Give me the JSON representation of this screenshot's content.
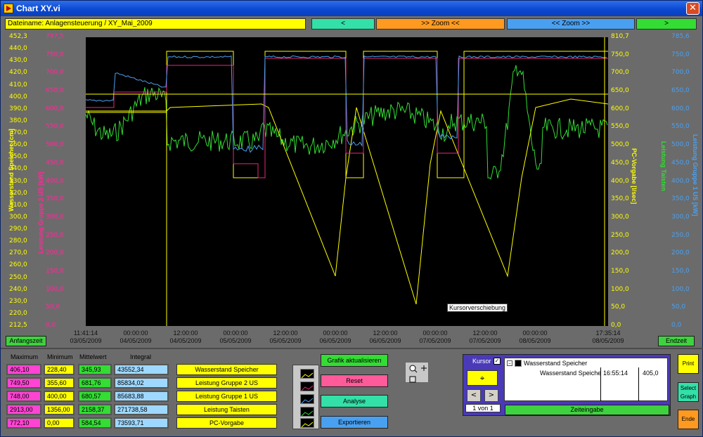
{
  "window": {
    "title": "Chart XY.vi",
    "close_glyph": "✕"
  },
  "header": {
    "filename": "Dateiname: Anlagensteuerung / XY_Mai_2009",
    "prev_label": "<",
    "zoom_in_label": ">> Zoom <<",
    "zoom_out_label": "<< Zoom >>",
    "next_label": ">"
  },
  "axes": {
    "ax1_ticks": [
      "452,3",
      "440,0",
      "430,0",
      "420,0",
      "410,0",
      "400,0",
      "390,0",
      "380,0",
      "370,0",
      "360,0",
      "350,0",
      "340,0",
      "330,0",
      "320,0",
      "310,0",
      "300,0",
      "290,0",
      "280,0",
      "270,0",
      "260,0",
      "250,0",
      "240,0",
      "230,0",
      "220,0",
      "212,5"
    ],
    "ax1_title": "Wasserstand Speicher [cm]",
    "ax2_ticks": [
      "797,5",
      "750,0",
      "700,0",
      "650,0",
      "600,0",
      "550,0",
      "500,0",
      "450,0",
      "400,0",
      "350,0",
      "300,0",
      "250,0",
      "200,0",
      "150,0",
      "100,0",
      "50,0",
      "0,0"
    ],
    "ax2_title": "Leistung Gruppe 2 US [kW]",
    "ax3_ticks": [
      "810,7",
      "750,0",
      "700,0",
      "650,0",
      "600,0",
      "550,0",
      "500,0",
      "450,0",
      "400,0",
      "350,0",
      "300,0",
      "250,0",
      "200,0",
      "150,0",
      "100,0",
      "50,0",
      "0,0"
    ],
    "ax3_title": "PC-Vorgabe [l/sec]",
    "ax4_ticks": [
      "",
      "",
      "",
      "",
      "",
      "",
      "",
      "",
      "",
      "",
      "",
      "",
      "",
      "",
      "",
      "",
      ""
    ],
    "ax4_title": "Leistung Taisten",
    "ax5_ticks": [
      "785,6",
      "750,0",
      "700,0",
      "650,0",
      "600,0",
      "550,0",
      "500,0",
      "450,0",
      "400,0",
      "350,0",
      "300,0",
      "250,0",
      "200,0",
      "150,0",
      "100,0",
      "50,0",
      "0,0"
    ],
    "ax5_title": "Leistung Gruppe 1 US [kW]"
  },
  "colors": {
    "yellow": "#ffff00",
    "magenta": "#e8287a",
    "green": "#33dd33",
    "blue": "#4aa0f0",
    "plot_bg": "#000000"
  },
  "x_ticks": [
    {
      "t": "11:41:14",
      "d": "03/05/2009"
    },
    {
      "t": "00:00:00",
      "d": "04/05/2009"
    },
    {
      "t": "12:00:00",
      "d": "04/05/2009"
    },
    {
      "t": "00:00:00",
      "d": "05/05/2009"
    },
    {
      "t": "12:00:00",
      "d": "05/05/2009"
    },
    {
      "t": "00:00:00",
      "d": "06/05/2009"
    },
    {
      "t": "12:00:00",
      "d": "06/05/2009"
    },
    {
      "t": "00:00:00",
      "d": "07/05/2009"
    },
    {
      "t": "12:00:00",
      "d": "07/05/2009"
    },
    {
      "t": "00:00:00",
      "d": "08/05/2009"
    },
    {
      "t": "17:35:14",
      "d": "08/05/2009"
    }
  ],
  "plot": {
    "cursor_label": "Kursorverschiebung"
  },
  "buttons": {
    "anfangszeit": "Anfangszeit",
    "endzeit": "Endzeit",
    "grafik": "Grafik aktualisieren",
    "reset": "Reset",
    "analyse": "Analyse",
    "exportieren": "Exportieren",
    "print": "Print",
    "select_graph": "Select Graph",
    "ende": "Ende",
    "zeiteingabe": "Zeiteingabe"
  },
  "stats": {
    "headers": [
      "Maximum",
      "Minimum",
      "Mittelwert",
      "Integral"
    ],
    "rows": [
      {
        "max": "406,10",
        "min": "228,40",
        "avg": "345,93",
        "int": "43552,34",
        "name": "Wasserstand Speicher"
      },
      {
        "max": "749,50",
        "min": "355,60",
        "avg": "681,76",
        "int": "85834,02",
        "name": "Leistung Gruppe 2 US"
      },
      {
        "max": "748,00",
        "min": "400,00",
        "avg": "680,57",
        "int": "85683,88",
        "name": "Leistung Gruppe 1 US"
      },
      {
        "max": "2913,00",
        "min": "1356,00",
        "avg": "2158,37",
        "int": "271738,58",
        "name": "Leistung Taisten"
      },
      {
        "max": "772,10",
        "min": "0,00",
        "avg": "584,54",
        "int": "73593,71",
        "name": "PC-Vorgabe"
      }
    ]
  },
  "cursor_panel": {
    "title": "Kursor",
    "tree_root": "Wasserstand Speicher",
    "row_name": "Wasserstand Speiche",
    "row_time": "16:55:14",
    "row_value": "405,0",
    "counter": "1 von 1",
    "prev": "<",
    "next": ">"
  }
}
